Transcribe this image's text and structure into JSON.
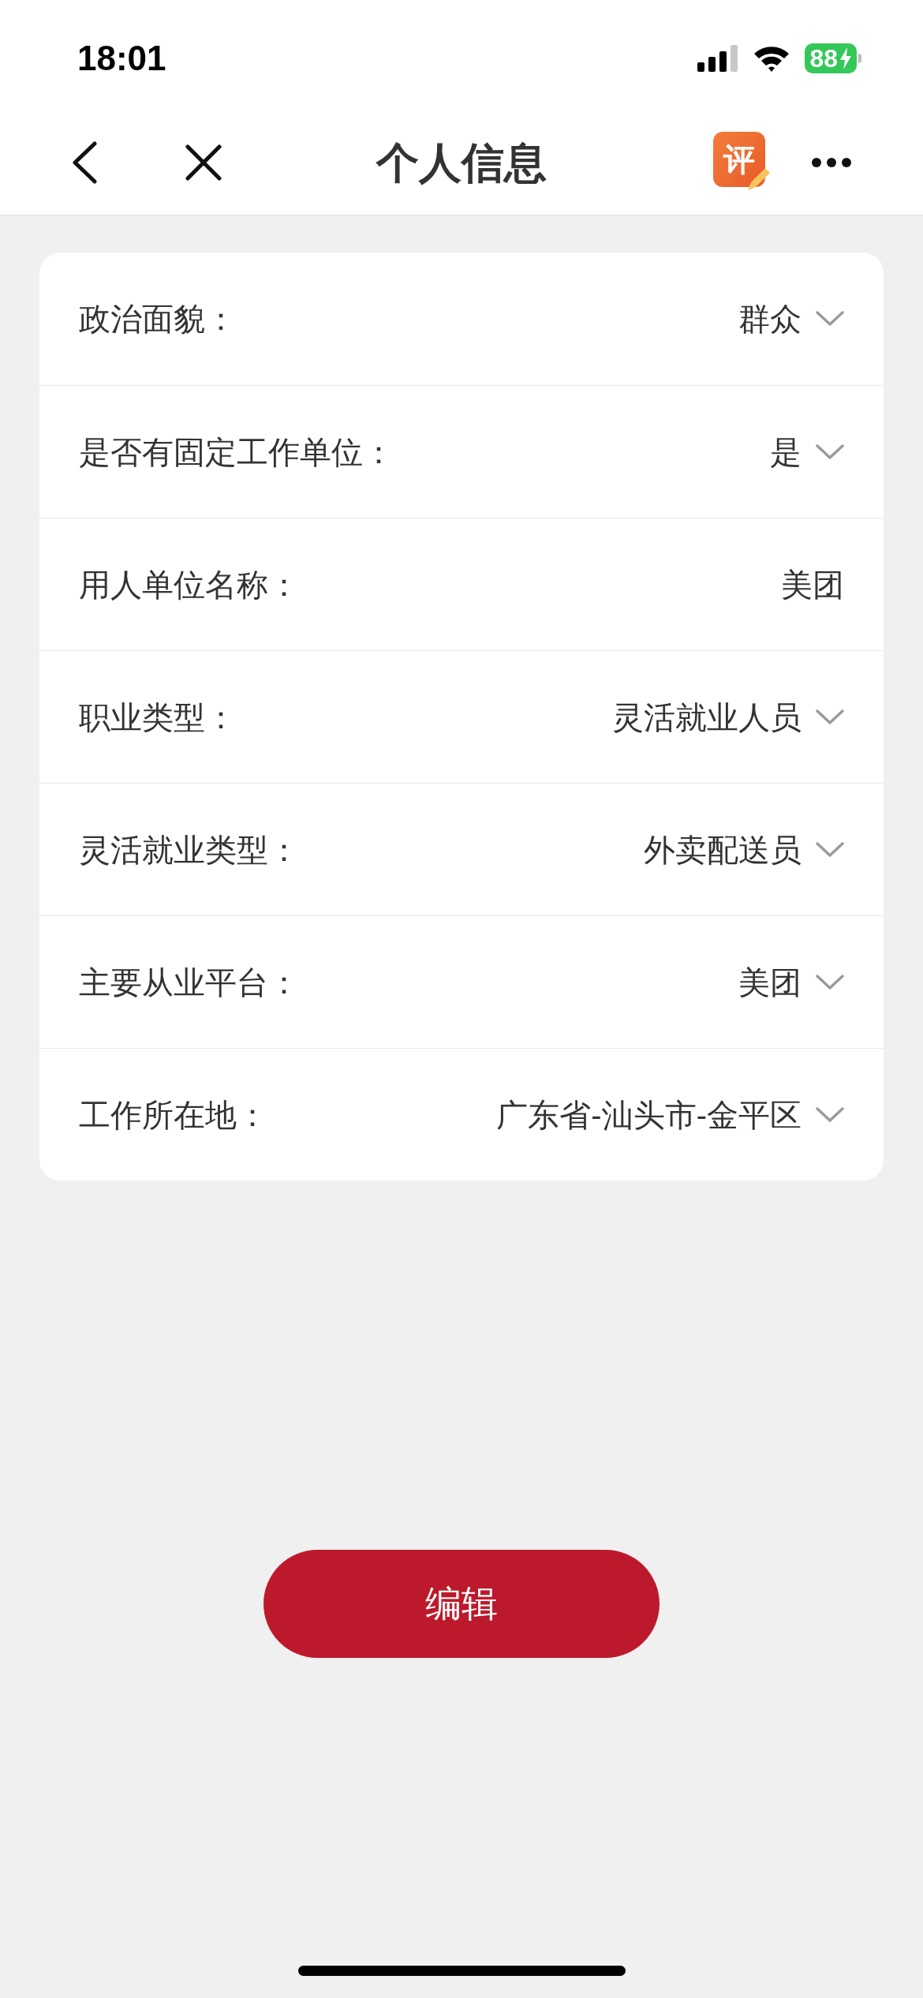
{
  "status_bar": {
    "time": "18:01",
    "battery": "88",
    "charging": true
  },
  "nav": {
    "title": "个人信息",
    "review_badge": "评"
  },
  "fields": [
    {
      "label": "政治面貌：",
      "value": "群众",
      "kind": "select"
    },
    {
      "label": "是否有固定工作单位：",
      "value": "是",
      "kind": "select"
    },
    {
      "label": "用人单位名称：",
      "value": "美团",
      "kind": "text"
    },
    {
      "label": "职业类型：",
      "value": "灵活就业人员",
      "kind": "select"
    },
    {
      "label": "灵活就业类型：",
      "value": "外卖配送员",
      "kind": "select"
    },
    {
      "label": "主要从业平台：",
      "value": "美团",
      "kind": "select"
    },
    {
      "label": "工作所在地：",
      "value": "广东省-汕头市-金平区",
      "kind": "select"
    }
  ],
  "edit_button": "编辑"
}
